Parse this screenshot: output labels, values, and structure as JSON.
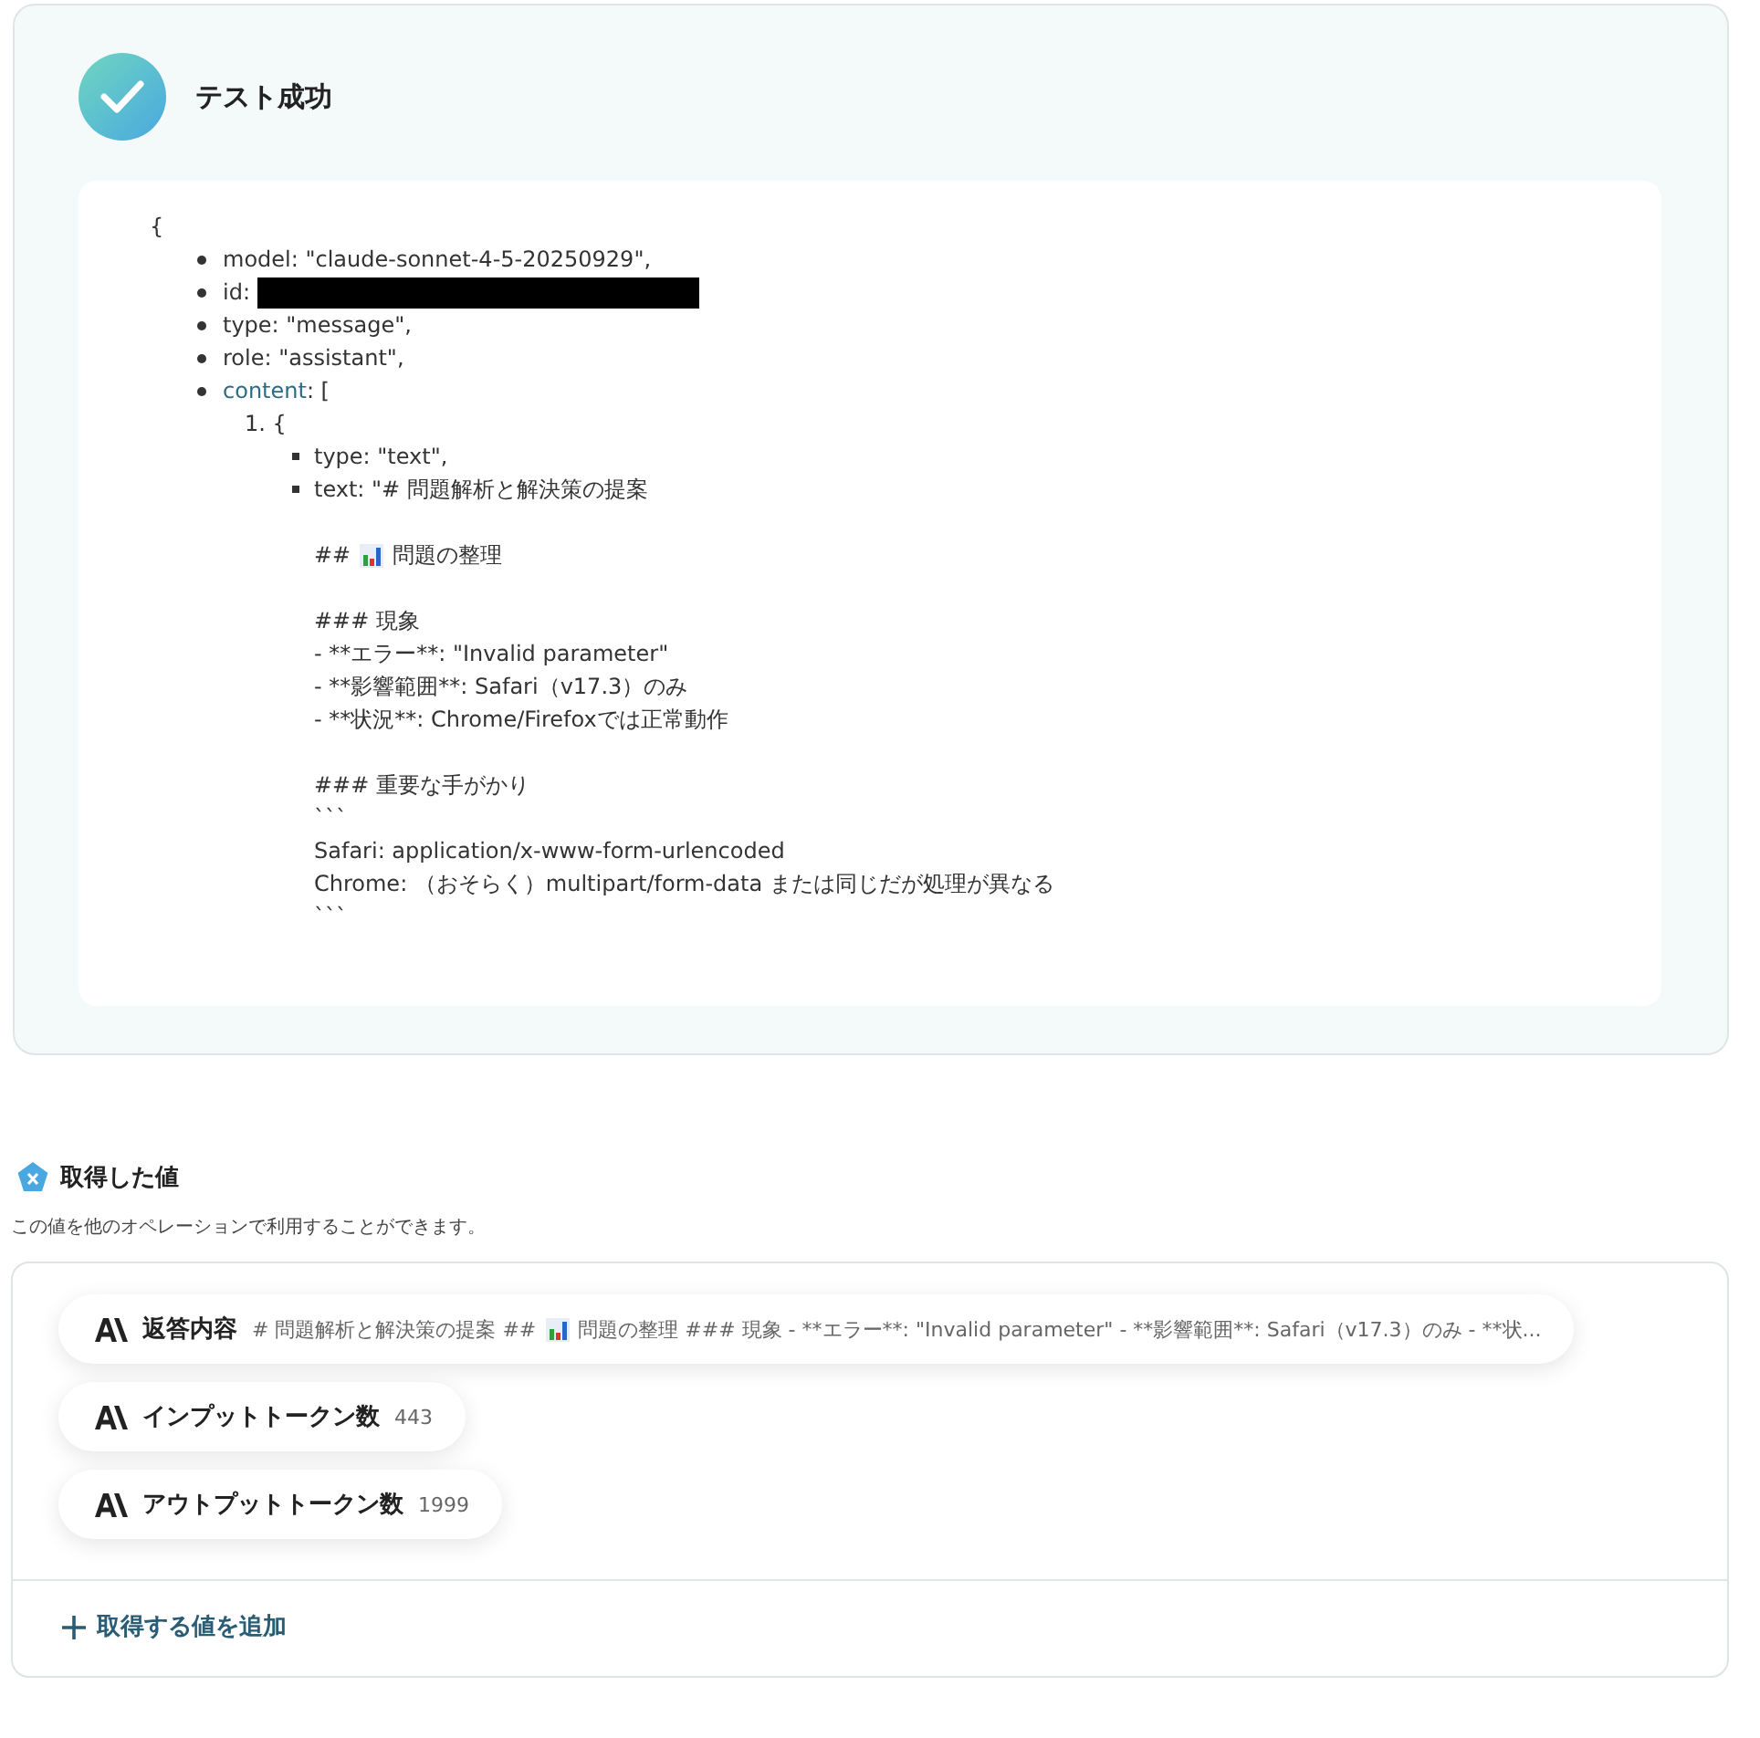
{
  "result": {
    "title": "テスト成功",
    "open_brace": "{",
    "fields": [
      {
        "kind": "text",
        "text": "model: \"claude-sonnet-4-5-20250929\","
      },
      {
        "kind": "redacted",
        "label": "id:"
      },
      {
        "kind": "text",
        "text": "type: \"message\","
      },
      {
        "kind": "text",
        "text": "role: \"assistant\","
      },
      {
        "kind": "array",
        "key": "content",
        "rest": ": [",
        "items": [
          {
            "number": "1.",
            "open": "{",
            "fields": [
              {
                "kind": "text",
                "text": "type: \"text\","
              },
              {
                "kind": "multiline",
                "paragraphs": [
                  {
                    "kind": "plain",
                    "lines": [
                      "text: \"# 問題解析と解決策の提案"
                    ]
                  },
                  {
                    "kind": "icon",
                    "before": "##",
                    "after": "問題の整理"
                  },
                  {
                    "kind": "plain",
                    "lines": [
                      "### 現象",
                      "- **エラー**: \"Invalid parameter\"",
                      "- **影響範囲**: Safari（v17.3）のみ",
                      "- **状況**: Chrome/Firefoxでは正常動作"
                    ]
                  },
                  {
                    "kind": "plain",
                    "lines": [
                      "### 重要な手がかり",
                      "```",
                      "Safari: application/x-www-form-urlencoded",
                      "Chrome: （おそらく）multipart/form-data または同じだが処理が異なる",
                      "```"
                    ]
                  }
                ]
              }
            ]
          }
        ]
      }
    ]
  },
  "values": {
    "title": "取得した値",
    "description": "この値を他のオペレーションで利用することができます。",
    "items": [
      {
        "label": "返答内容",
        "value_before": "# 問題解析と解決策の提案 ##",
        "value_after": "問題の整理 ### 現象 - **エラー**: \"Invalid parameter\" - **影響範囲**: Safari（v17.3）のみ - **状..."
      },
      {
        "label": "インプットトークン数",
        "value_before": "443"
      },
      {
        "label": "アウトプットトークン数",
        "value_before": "1999"
      }
    ],
    "add_button": "取得する値を追加"
  }
}
